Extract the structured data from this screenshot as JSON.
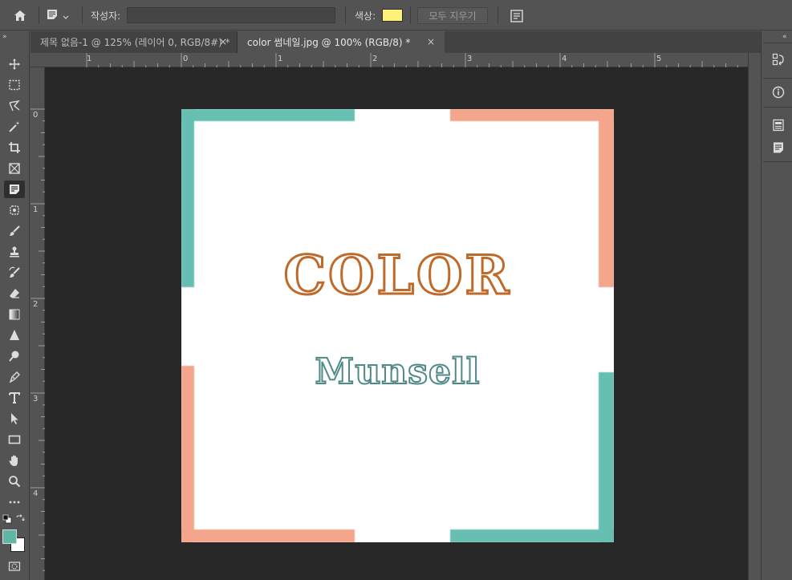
{
  "option_bar": {
    "author_label": "작성자:",
    "author_value": "",
    "color_label": "색상:",
    "note_color": "#fdf177",
    "clear_all_label": "모두 지우기"
  },
  "tabs": [
    {
      "label": "제목 없음-1 @ 125% (레이어 0, RGB/8#) *",
      "close": "×"
    },
    {
      "label": "color 썸네일.jpg @ 100% (RGB/8) *",
      "close": "×"
    }
  ],
  "rulers": {
    "top": [
      "1",
      "0",
      "1",
      "2",
      "3",
      "4",
      "5"
    ],
    "left": [
      "0",
      "1",
      "2",
      "3",
      "4"
    ]
  },
  "tools": [
    "move-tool",
    "marquee-tool",
    "lasso-tool",
    "magic-wand-tool",
    "crop-tool",
    "frame-tool",
    "note-tool",
    "patch-tool",
    "brush-tool",
    "stamp-tool",
    "history-brush-tool",
    "eraser-tool",
    "gradient-tool",
    "blur-tool",
    "dodge-tool",
    "pen-tool",
    "type-tool",
    "path-selection-tool",
    "rectangle-tool",
    "hand-tool",
    "zoom-tool",
    "more-tools"
  ],
  "colors": {
    "foreground": "#5fb6a6",
    "background": "#ffffff",
    "accent_teal": "#66bfb0",
    "accent_salmon": "#f3a68c",
    "title_color": "#bf6a2a",
    "subtitle_color": "#4f8a86"
  },
  "canvas": {
    "title": "COLOR",
    "subtitle": "Munsell"
  }
}
